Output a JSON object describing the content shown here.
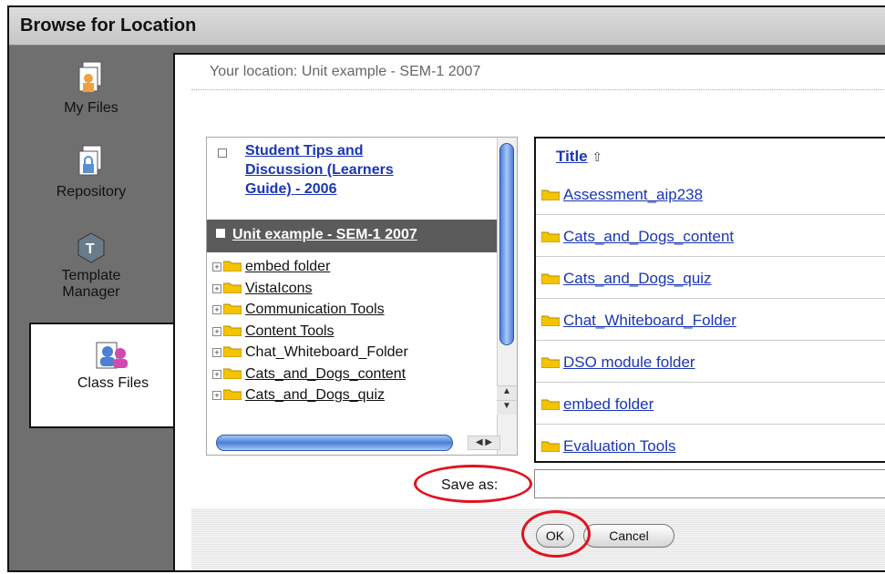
{
  "window": {
    "title": "Browse for Location"
  },
  "sidebar": {
    "items": [
      {
        "label": "My Files",
        "icon": "my-files-icon"
      },
      {
        "label": "Repository",
        "icon": "repository-lock-icon"
      },
      {
        "label_line1": "Template",
        "label_line2": "Manager",
        "icon": "template-manager-icon"
      },
      {
        "label": "Class Files",
        "icon": "class-files-people-icon",
        "active": true
      }
    ]
  },
  "location": {
    "text": "Your location: Unit example - SEM-1 2007"
  },
  "tree": {
    "previous_item": {
      "line1": "Student Tips and",
      "line2": "Discussion (Learners",
      "line3": "Guide) - 2006"
    },
    "current": "Unit example - SEM-1 2007",
    "items": [
      "embed folder",
      "VistaIcons",
      "Communication Tools",
      "Content Tools",
      "Chat_Whiteboard_Folder",
      "Cats_and_Dogs_content",
      "Cats_and_Dogs_quiz"
    ]
  },
  "filelist": {
    "column_title": "Title",
    "sort_indicator": "⇧",
    "items": [
      "Assessment_aip238",
      "Cats_and_Dogs_content",
      "Cats_and_Dogs_quiz",
      "Chat_Whiteboard_Folder",
      "DSO module folder",
      "embed folder",
      "Evaluation Tools"
    ]
  },
  "save_as": {
    "label": "Save as:",
    "value": ""
  },
  "buttons": {
    "ok": "OK",
    "cancel": "Cancel"
  },
  "colors": {
    "link": "#1a36b5",
    "folder": "#f5c400",
    "highlight_ring": "#e0141e",
    "scroll": "#4a7fd8"
  }
}
